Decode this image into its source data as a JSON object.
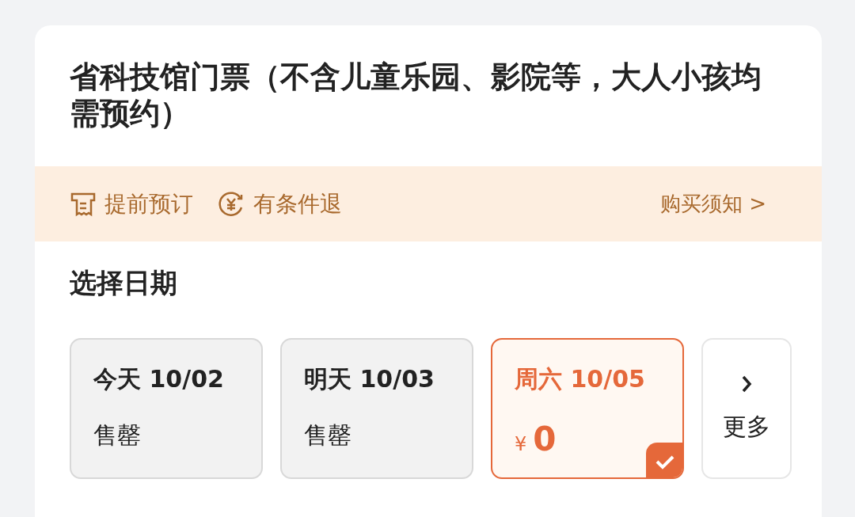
{
  "title": "省科技馆门票（不含儿童乐园、影院等，大人小孩均需预约）",
  "notice_bar": {
    "tags": [
      {
        "kind": "receipt",
        "label": "提前预订"
      },
      {
        "kind": "refund",
        "label": "有条件退"
      }
    ],
    "link": "购买须知 >"
  },
  "date_section": {
    "heading": "选择日期",
    "dates": [
      {
        "kind": "soldout",
        "label": "今天 10/02",
        "status": "售罄",
        "selected": false
      },
      {
        "kind": "soldout",
        "label": "明天 10/03",
        "status": "售罄",
        "selected": false
      },
      {
        "kind": "price",
        "label": "周六 10/05",
        "currency": "¥",
        "price": "0",
        "selected": true
      }
    ],
    "more": "更多"
  }
}
